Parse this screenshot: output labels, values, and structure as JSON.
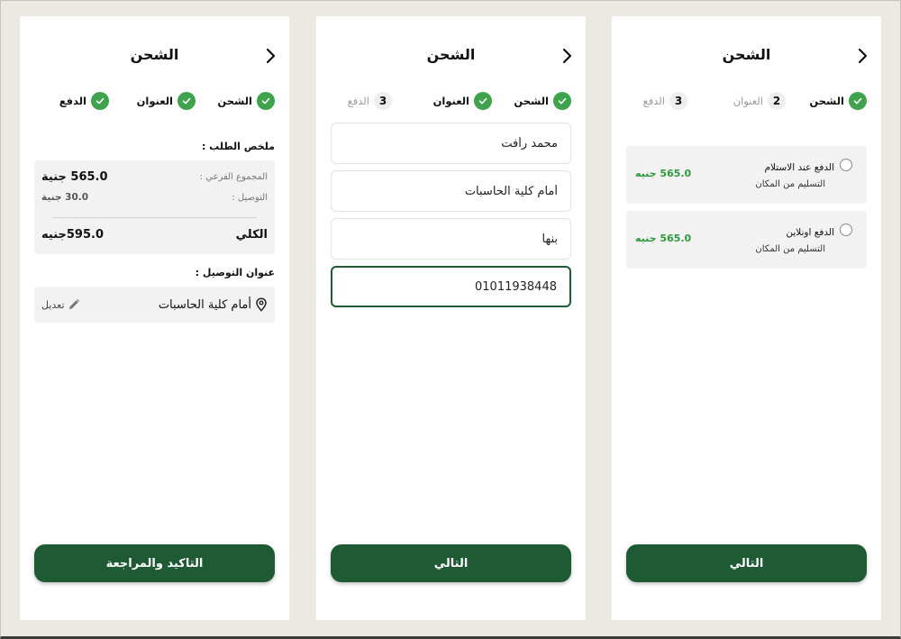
{
  "colors": {
    "primary": "#1e5a33",
    "check": "#3fa34d",
    "price": "#2e9a3e",
    "card": "#f2f2f2"
  },
  "screen1": {
    "title": "الشحن",
    "steps": [
      {
        "label": "الشحن",
        "state": "done"
      },
      {
        "label": "العنوان",
        "state": "done"
      },
      {
        "label": "الدفع",
        "state": "done"
      }
    ],
    "summary_title": "ملخص الطلب :",
    "subtotal_label": "المجموع الفرعي :",
    "subtotal_value": "565.0 جنية",
    "delivery_label": "التوصيل :",
    "delivery_value": "30.0 جنية",
    "total_label": "الكلي",
    "total_value": "595.0جنيه",
    "address_title": "عنوان التوصيل :",
    "address_value": "أمام كلية الحاسبات",
    "edit_label": "تعديل",
    "cta": "التاكيد والمراجعة"
  },
  "screen2": {
    "title": "الشحن",
    "steps": [
      {
        "label": "الشحن",
        "state": "done"
      },
      {
        "label": "العنوان",
        "state": "done"
      },
      {
        "label": "الدفع",
        "state": "pending",
        "number": "3"
      }
    ],
    "fields": [
      {
        "value": "محمد رأفت"
      },
      {
        "value": "أمام كلية الحاسبات"
      },
      {
        "value": "بنها"
      },
      {
        "value": "01011938448"
      }
    ],
    "cta": "التالي"
  },
  "screen3": {
    "title": "الشحن",
    "steps": [
      {
        "label": "الشحن",
        "state": "done"
      },
      {
        "label": "العنوان",
        "state": "pending",
        "number": "2"
      },
      {
        "label": "الدفع",
        "state": "pending",
        "number": "3"
      }
    ],
    "options": [
      {
        "name": "الدفع عند الاستلام",
        "sub": "التسليم من المكان",
        "price": "565.0 جنيه"
      },
      {
        "name": "الدفع اونلاين",
        "sub": "التسليم من المكان",
        "price": "565.0 جنيه"
      }
    ],
    "cta": "التالي"
  }
}
